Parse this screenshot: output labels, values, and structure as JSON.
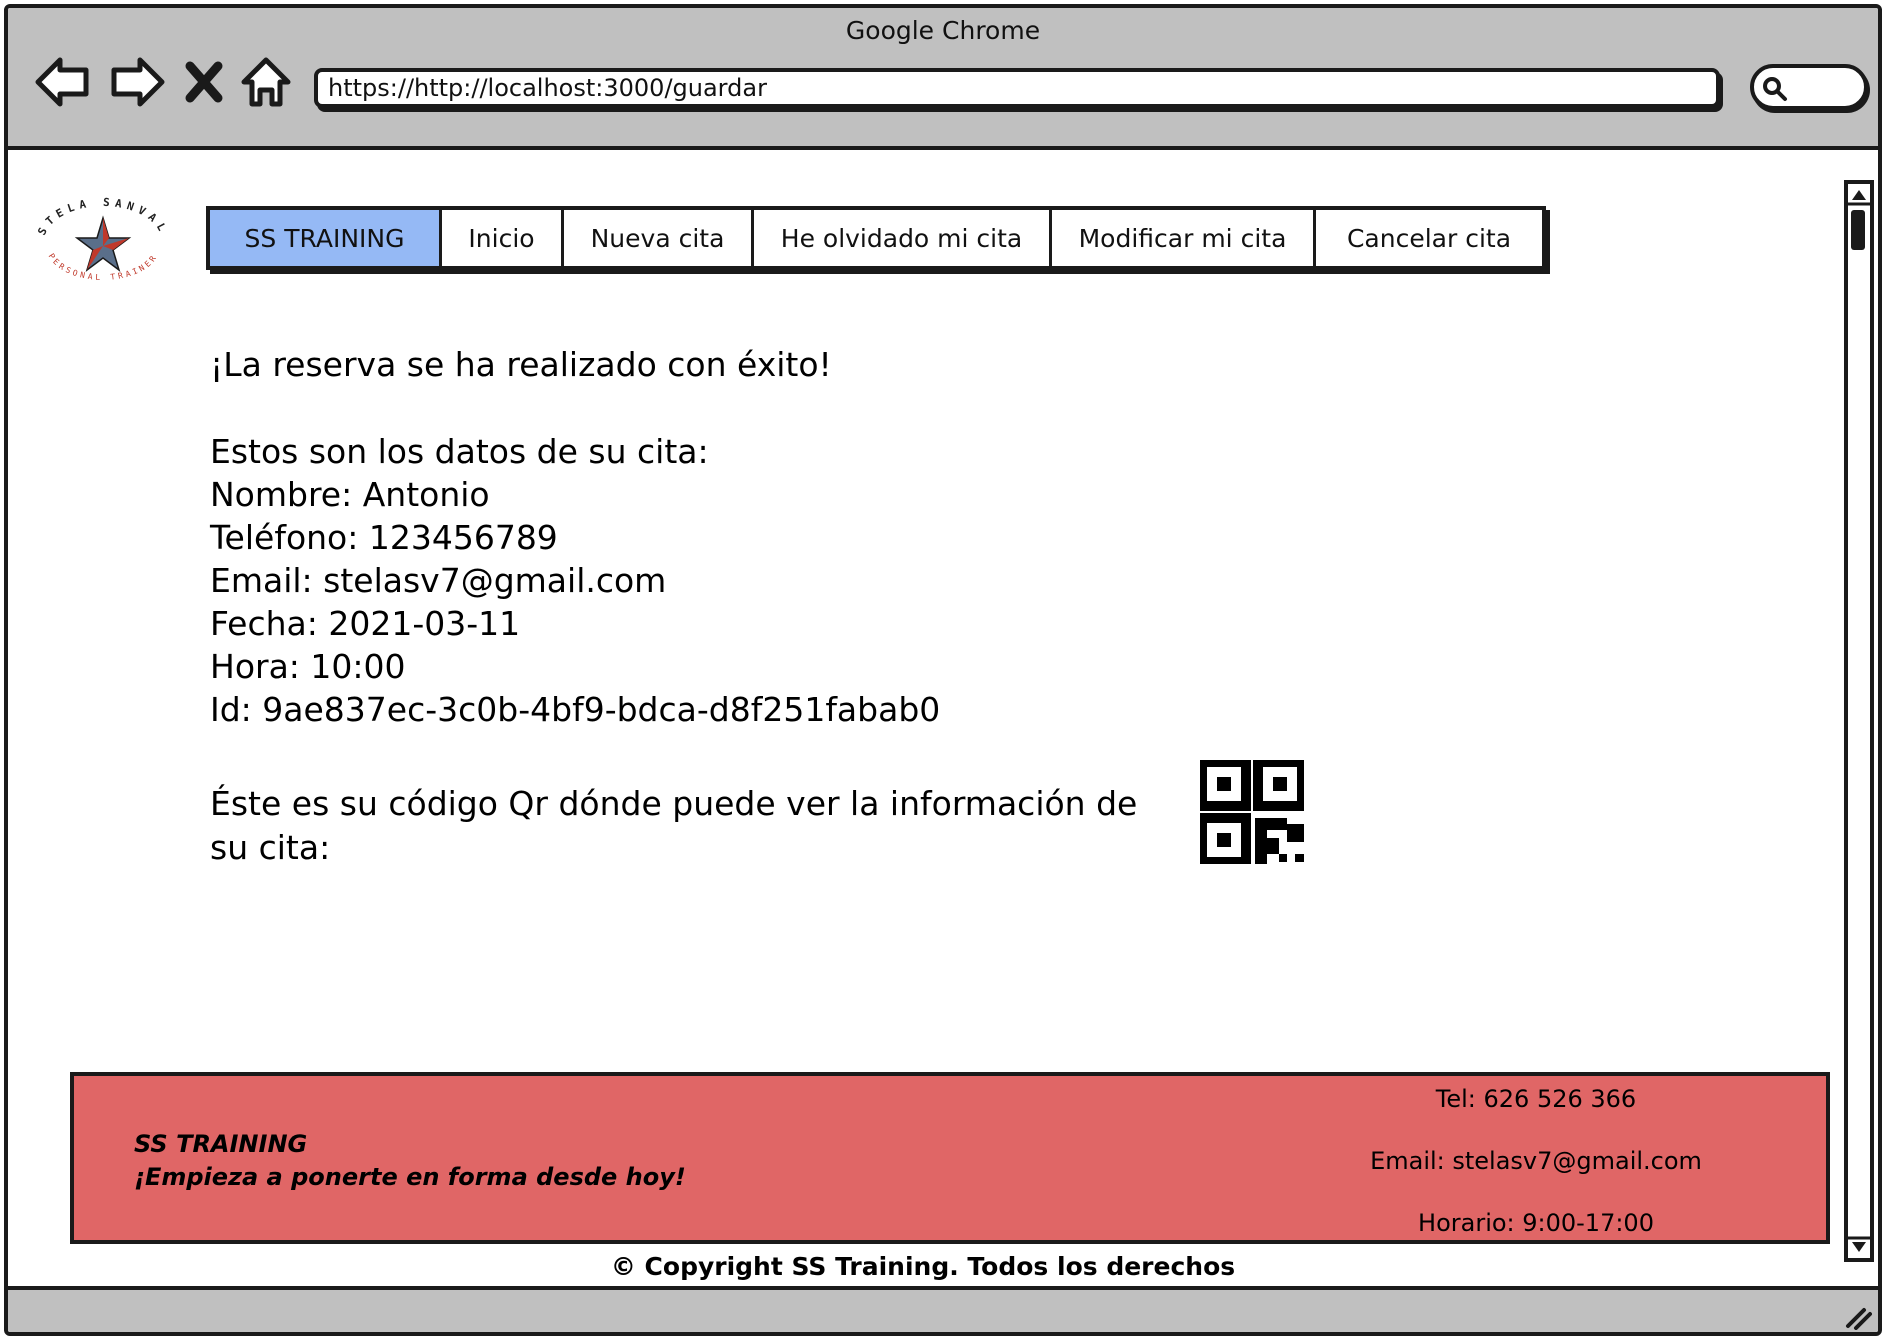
{
  "browser": {
    "window_title": "Google Chrome",
    "url": "https://http://localhost:3000/guardar",
    "icons": [
      "back-arrow-icon",
      "forward-arrow-icon",
      "close-x-icon",
      "home-icon",
      "search-icon"
    ]
  },
  "logo": {
    "text_top": "STELA SANVAL",
    "text_bottom": "PERSONAL TRAINER",
    "star_color": "#5a6f8a",
    "accent_color": "#c0392b"
  },
  "nav": {
    "tabs": [
      {
        "label": "SS TRAINING",
        "active": true
      },
      {
        "label": "Inicio",
        "active": false
      },
      {
        "label": "Nueva cita",
        "active": false
      },
      {
        "label": "He olvidado mi cita",
        "active": false
      },
      {
        "label": "Modificar mi cita",
        "active": false
      },
      {
        "label": "Cancelar cita",
        "active": false
      }
    ],
    "active_color": "#95b9f5"
  },
  "main": {
    "success_message": "¡La reserva se ha realizado con éxito!",
    "details_intro": "Estos son los datos de su cita:",
    "details": [
      "Nombre: Antonio",
      "Teléfono: 123456789",
      "Email: stelasv7@gmail.com",
      "Fecha: 2021-03-11",
      "Hora: 10:00",
      "Id: 9ae837ec-3c0b-4bf9-bdca-d8f251fabab0"
    ],
    "qr_text": "Éste es su código Qr dónde puede ver la información de su cita:"
  },
  "footer": {
    "brand": "SS TRAINING",
    "tagline": "¡Empieza a ponerte en forma desde hoy!",
    "phone": "Tel: 626 526 366",
    "email": "Email: stelasv7@gmail.com",
    "hours": "Horario: 9:00-17:00",
    "copyright": "© Copyright SS Training. Todos los derechos",
    "background_color": "#e06666"
  }
}
